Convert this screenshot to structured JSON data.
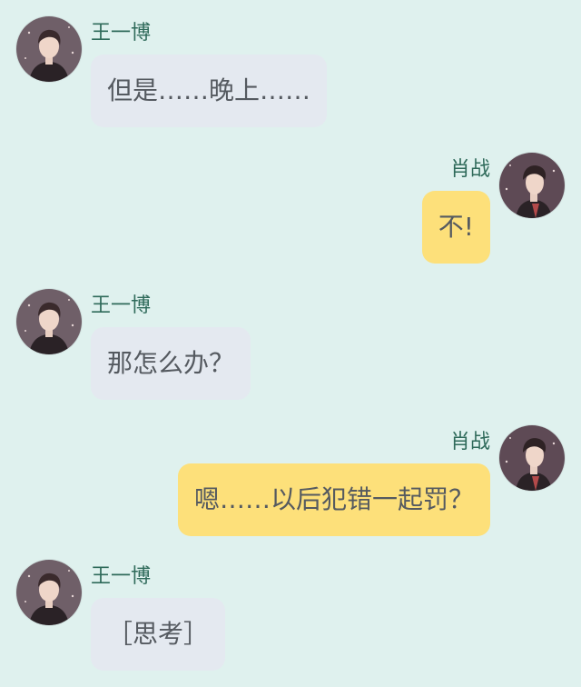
{
  "chat": {
    "messages": [
      {
        "side": "left",
        "sender": "王一博",
        "text": "但是……晚上……",
        "avatar_icon": "avatar-wang-yibo"
      },
      {
        "side": "right",
        "sender": "肖战",
        "text": "不!",
        "avatar_icon": "avatar-xiao-zhan"
      },
      {
        "side": "left",
        "sender": "王一博",
        "text": "那怎么办？",
        "avatar_icon": "avatar-wang-yibo"
      },
      {
        "side": "right",
        "sender": "肖战",
        "text": "嗯……以后犯错一起罚？",
        "avatar_icon": "avatar-xiao-zhan"
      },
      {
        "side": "left",
        "sender": "王一博",
        "text": "［思考］",
        "avatar_icon": "avatar-wang-yibo"
      }
    ]
  },
  "colors": {
    "background": "#dff1ee",
    "left_bubble": "#e4e9f0",
    "right_bubble": "#fde07a",
    "name_text": "#2f6a5a",
    "message_text": "#555a60"
  }
}
